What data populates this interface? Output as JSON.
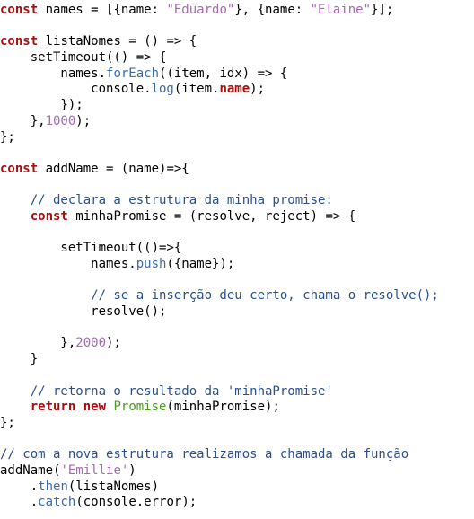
{
  "editor": {
    "colors": {
      "keyword": "#aa0d0d",
      "string": "#a36ab0",
      "number": "#a36ab0",
      "function_call": "#3d6aa8",
      "comment": "#2a4f8a",
      "class_name": "#4b9a22",
      "default": "#000000",
      "background": "#ffffff"
    },
    "lines": [
      [
        {
          "t": "kw",
          "v": "const"
        },
        {
          "t": "plain",
          "v": " names = [{name: "
        },
        {
          "t": "str",
          "v": "\"Eduardo\""
        },
        {
          "t": "plain",
          "v": "}, {name: "
        },
        {
          "t": "str",
          "v": "\"Elaine\""
        },
        {
          "t": "plain",
          "v": "}];"
        }
      ],
      [],
      [
        {
          "t": "kw",
          "v": "const"
        },
        {
          "t": "plain",
          "v": " listaNomes = () => {"
        }
      ],
      [
        {
          "t": "plain",
          "v": "    setTimeout(() => {"
        }
      ],
      [
        {
          "t": "plain",
          "v": "        names."
        },
        {
          "t": "fn",
          "v": "forEach"
        },
        {
          "t": "plain",
          "v": "((item, idx) => {"
        }
      ],
      [
        {
          "t": "plain",
          "v": "            console."
        },
        {
          "t": "fn",
          "v": "log"
        },
        {
          "t": "plain",
          "v": "(item."
        },
        {
          "t": "prop",
          "v": "name"
        },
        {
          "t": "plain",
          "v": ");"
        }
      ],
      [
        {
          "t": "plain",
          "v": "        });"
        }
      ],
      [
        {
          "t": "plain",
          "v": "    },"
        },
        {
          "t": "num",
          "v": "1000"
        },
        {
          "t": "plain",
          "v": ");"
        }
      ],
      [
        {
          "t": "plain",
          "v": "};"
        }
      ],
      [],
      [
        {
          "t": "kw",
          "v": "const"
        },
        {
          "t": "plain",
          "v": " addName = (name)=>{"
        }
      ],
      [],
      [
        {
          "t": "cm",
          "v": "    // declara a estrutura da minha promise:"
        }
      ],
      [
        {
          "t": "plain",
          "v": "    "
        },
        {
          "t": "kw",
          "v": "const"
        },
        {
          "t": "plain",
          "v": " minhaPromise = (resolve, reject) => {"
        }
      ],
      [],
      [
        {
          "t": "plain",
          "v": "        setTimeout(()=>{"
        }
      ],
      [
        {
          "t": "plain",
          "v": "            names."
        },
        {
          "t": "fn",
          "v": "push"
        },
        {
          "t": "plain",
          "v": "({name});"
        }
      ],
      [],
      [
        {
          "t": "cm",
          "v": "            // se a inserção deu certo, chama o resolve();"
        }
      ],
      [
        {
          "t": "plain",
          "v": "            resolve();"
        }
      ],
      [],
      [
        {
          "t": "plain",
          "v": "        },"
        },
        {
          "t": "num",
          "v": "2000"
        },
        {
          "t": "plain",
          "v": ");"
        }
      ],
      [
        {
          "t": "plain",
          "v": "    }"
        }
      ],
      [],
      [
        {
          "t": "cm",
          "v": "    // retorna o resultado da 'minhaPromise'"
        }
      ],
      [
        {
          "t": "plain",
          "v": "    "
        },
        {
          "t": "kw",
          "v": "return"
        },
        {
          "t": "plain",
          "v": " "
        },
        {
          "t": "kw",
          "v": "new"
        },
        {
          "t": "plain",
          "v": " "
        },
        {
          "t": "cls",
          "v": "Promise"
        },
        {
          "t": "plain",
          "v": "(minhaPromise);"
        }
      ],
      [
        {
          "t": "plain",
          "v": "};"
        }
      ],
      [],
      [
        {
          "t": "cm",
          "v": "// com a nova estrutura realizamos a chamada da função"
        }
      ],
      [
        {
          "t": "plain",
          "v": "addName("
        },
        {
          "t": "str",
          "v": "'Emillie'"
        },
        {
          "t": "plain",
          "v": ")"
        }
      ],
      [
        {
          "t": "plain",
          "v": "    ."
        },
        {
          "t": "fn",
          "v": "then"
        },
        {
          "t": "plain",
          "v": "(listaNomes)"
        }
      ],
      [
        {
          "t": "plain",
          "v": "    ."
        },
        {
          "t": "fn",
          "v": "catch"
        },
        {
          "t": "plain",
          "v": "(console.error);"
        }
      ]
    ]
  }
}
